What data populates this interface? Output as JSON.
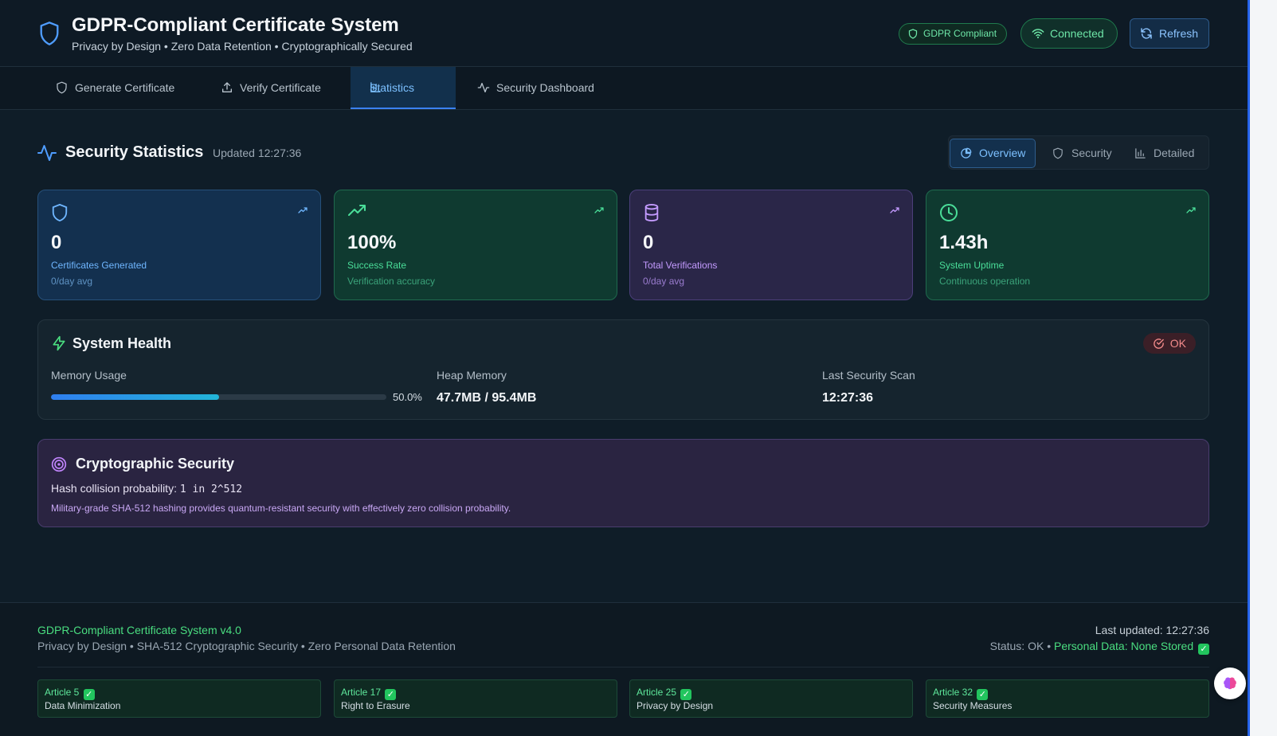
{
  "header": {
    "title": "GDPR-Compliant Certificate System",
    "subtitle": "Privacy by Design • Zero Data Retention • Cryptographically Secured",
    "gdpr_badge": "GDPR Compliant",
    "connection": "Connected",
    "refresh_label": "Refresh"
  },
  "tabs": [
    {
      "label": "Generate Certificate",
      "icon": "shield-icon"
    },
    {
      "label": "Verify Certificate",
      "icon": "upload-icon"
    },
    {
      "label": "Statistics",
      "icon": "bar-chart-icon",
      "active": true
    },
    {
      "label": "Security Dashboard",
      "icon": "activity-icon"
    }
  ],
  "section": {
    "title": "Security Statistics",
    "updated": "Updated 12:27:36",
    "views": [
      "Overview",
      "Security",
      "Detailed"
    ],
    "active_view": "Overview"
  },
  "cards": [
    {
      "value": "0",
      "label": "Certificates Generated",
      "sub": "0/day avg",
      "icon": "shield-icon",
      "color": "#6fb6ff"
    },
    {
      "value": "100%",
      "label": "Success Rate",
      "sub": "Verification accuracy",
      "icon": "trending-up-icon",
      "color": "#4ade99"
    },
    {
      "value": "0",
      "label": "Total Verifications",
      "sub": "0/day avg",
      "icon": "database-icon",
      "color": "#c49bff"
    },
    {
      "value": "1.43h",
      "label": "System Uptime",
      "sub": "Continuous operation",
      "icon": "clock-icon",
      "color": "#4ade99"
    }
  ],
  "health": {
    "title": "System Health",
    "status": "OK",
    "memory_label": "Memory Usage",
    "memory_percent": 0.5,
    "memory_percent_text": "50.0%",
    "heap_label": "Heap Memory",
    "heap_value": "47.7MB / 95.4MB",
    "scan_label": "Last Security Scan",
    "scan_value": "12:27:36"
  },
  "crypto": {
    "title": "Cryptographic Security",
    "collision_label": "Hash collision probability:",
    "collision_value": "1 in 2^512",
    "description": "Military-grade SHA-512 hashing provides quantum-resistant security with effectively zero collision probability."
  },
  "footer": {
    "title": "GDPR-Compliant Certificate System v4.0",
    "subtitle": "Privacy by Design • SHA-512 Cryptographic Security • Zero Personal Data Retention",
    "last_updated": "Last updated: 12:27:36",
    "status_prefix": "Status: OK •",
    "status_data": "Personal Data: None Stored",
    "articles": [
      {
        "article": "Article 5",
        "name": "Data Minimization"
      },
      {
        "article": "Article 17",
        "name": "Right to Erasure"
      },
      {
        "article": "Article 25",
        "name": "Privacy by Design"
      },
      {
        "article": "Article 32",
        "name": "Security Measures"
      }
    ]
  }
}
